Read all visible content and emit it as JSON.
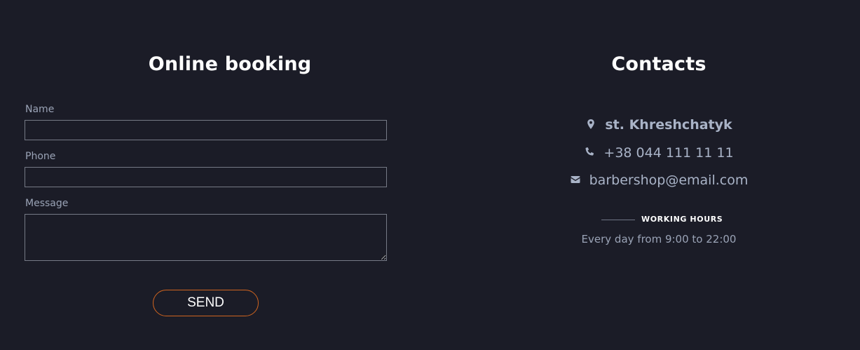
{
  "booking": {
    "title": "Online booking",
    "name_label": "Name",
    "phone_label": "Phone",
    "message_label": "Message",
    "name_value": "",
    "phone_value": "",
    "message_value": "",
    "send_label": "SEND"
  },
  "contacts": {
    "title": "Contacts",
    "address": "st. Khreshchatyk",
    "phone": "+38 044 111 11 11",
    "email": "barbershop@email.com",
    "hours_title": "WORKING HOURS",
    "hours_text": "Every day from 9:00 to 22:00",
    "address_icon": "map-pin-icon",
    "phone_icon": "phone-icon",
    "email_icon": "envelope-icon"
  },
  "colors": {
    "background": "#1b1c27",
    "heading": "#ffffff",
    "text": "#a9b3c7",
    "input_border": "#767a86",
    "button_border": "#d0641f"
  }
}
